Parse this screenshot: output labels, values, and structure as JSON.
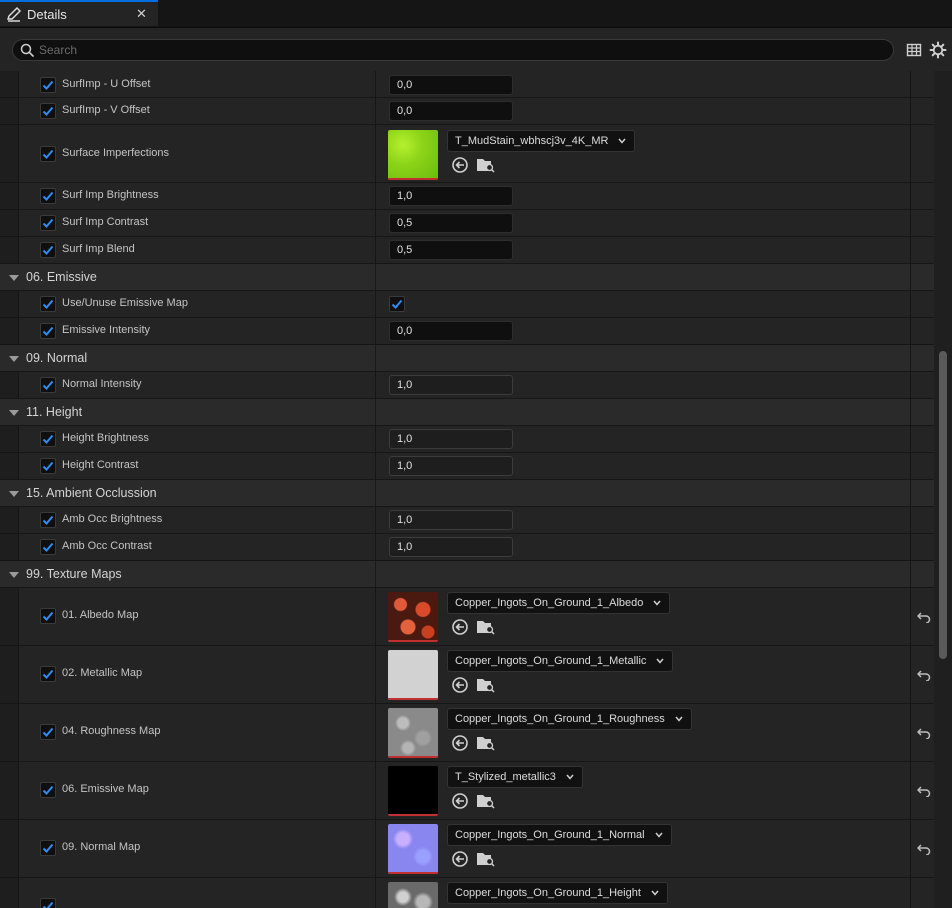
{
  "tab": {
    "title": "Details",
    "close": "✕"
  },
  "search": {
    "placeholder": "Search",
    "value": ""
  },
  "rows": {
    "surfimp_u": {
      "label": "SurfImp - U Offset",
      "value": "0,0"
    },
    "surfimp_v": {
      "label": "SurfImp - V Offset",
      "value": "0,0"
    },
    "surface_imperfections": {
      "label": "Surface Imperfections",
      "asset": "T_MudStain_wbhscj3v_4K_MR"
    },
    "surf_imp_brightness": {
      "label": "Surf Imp Brightness",
      "value": "1,0"
    },
    "surf_imp_contrast": {
      "label": "Surf Imp Contrast",
      "value": "0,5"
    },
    "surf_imp_blend": {
      "label": "Surf Imp Blend",
      "value": "0,5"
    },
    "cat_emissive": {
      "label": "06. Emissive"
    },
    "use_emissive_map": {
      "label": "Use/Unuse Emissive Map"
    },
    "emissive_intensity": {
      "label": "Emissive Intensity",
      "value": "0,0"
    },
    "cat_normal": {
      "label": "09. Normal"
    },
    "normal_intensity": {
      "label": "Normal Intensity",
      "value": "1,0"
    },
    "cat_height": {
      "label": "11. Height"
    },
    "height_brightness": {
      "label": "Height Brightness",
      "value": "1,0"
    },
    "height_contrast": {
      "label": "Height Contrast",
      "value": "1,0"
    },
    "cat_ao": {
      "label": "15. Ambient Occlussion"
    },
    "amb_occ_brightness": {
      "label": "Amb Occ Brightness",
      "value": "1,0"
    },
    "amb_occ_contrast": {
      "label": "Amb Occ Contrast",
      "value": "1,0"
    },
    "cat_texture_maps": {
      "label": "99. Texture Maps"
    },
    "albedo_map": {
      "label": "01. Albedo Map",
      "asset": "Copper_Ingots_On_Ground_1_Albedo"
    },
    "metallic_map": {
      "label": "02. Metallic Map",
      "asset": "Copper_Ingots_On_Ground_1_Metallic"
    },
    "roughness_map": {
      "label": "04. Roughness Map",
      "asset": "Copper_Ingots_On_Ground_1_Roughness"
    },
    "emissive_map": {
      "label": "06. Emissive Map",
      "asset": "T_Stylized_metallic3"
    },
    "normal_map": {
      "label": "09. Normal Map",
      "asset": "Copper_Ingots_On_Ground_1_Normal"
    },
    "height_map": {
      "label": "",
      "asset": "Copper_Ingots_On_Ground_1_Height"
    }
  },
  "colors": {
    "accent": "#0070e0",
    "panel_bg": "#242424",
    "category_bg": "#2a2a2a",
    "checkbox_check": "#2f8cf2",
    "texture_outline": "#c03030"
  },
  "icons": {
    "tab": "pencil-edit-icon",
    "search": "search-icon",
    "table": "table-view-icon",
    "settings": "gear-icon",
    "use_selected": "use-selected-asset-icon",
    "browse": "browse-folder-icon",
    "reset": "reset-to-default-icon"
  }
}
